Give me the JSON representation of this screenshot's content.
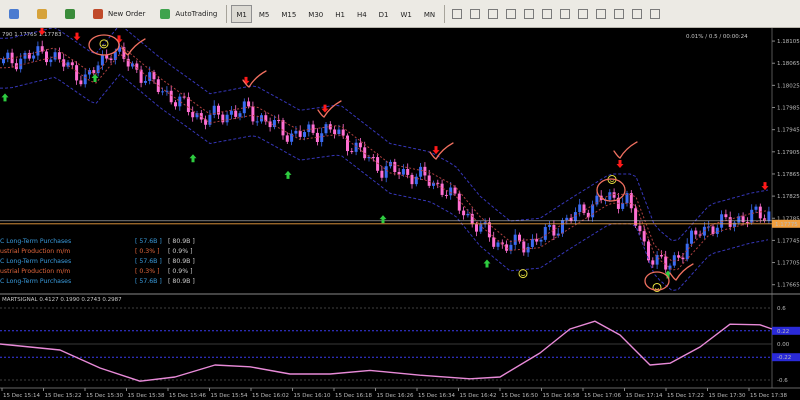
{
  "toolbar": {
    "buttons": [
      {
        "label": "",
        "icon": "new-chart-icon"
      },
      {
        "label": "",
        "icon": "profiles-icon"
      },
      {
        "label": "",
        "icon": "navigator-icon"
      },
      {
        "label": "New Order",
        "icon": "new-order-icon"
      },
      {
        "label": "AutoTrading",
        "icon": "autotrading-icon"
      }
    ],
    "timeframes": [
      "M1",
      "M5",
      "M15",
      "M30",
      "H1",
      "H4",
      "D1",
      "W1",
      "MN"
    ],
    "active_timeframe": "M1"
  },
  "chart": {
    "symbol_info": "790 1.17765 1.17783",
    "status": "0.01% / 0.5 / 00:00:24",
    "status_color": "#f4a742",
    "current_price": "1.17775",
    "price_labels": [
      "1.18105",
      "1.18065",
      "1.18025",
      "1.17985",
      "1.17945",
      "1.17905",
      "1.17865",
      "1.17825",
      "1.17785",
      "1.17745",
      "1.17705",
      "1.17665"
    ],
    "time_labels": [
      "15 Dec 15:14",
      "15 Dec 15:22",
      "15 Dec 15:30",
      "15 Dec 15:38",
      "15 Dec 15:46",
      "15 Dec 15:54",
      "15 Dec 16:02",
      "15 Dec 16:10",
      "15 Dec 16:18",
      "15 Dec 16:26",
      "15 Dec 16:34",
      "15 Dec 16:42",
      "15 Dec 16:50",
      "15 Dec 16:58",
      "15 Dec 17:06",
      "15 Dec 17:14",
      "15 Dec 17:22",
      "15 Dec 17:30",
      "15 Dec 17:38"
    ],
    "news_events": [
      {
        "name": "C Long-Term Purchases",
        "actual": "[ 57.6B ]",
        "previous": "[ 80.9B ]",
        "color": "#3a9bdc"
      },
      {
        "name": "ustrial Production m/m",
        "actual": "[ 0.3% ]",
        "previous": "[ 0.9% ]",
        "color": "#e0663c"
      },
      {
        "name": "C Long-Term Purchases",
        "actual": "[ 57.6B ]",
        "previous": "[ 80.9B ]",
        "color": "#3a9bdc"
      },
      {
        "name": "ustrial Production m/m",
        "actual": "[ 0.3% ]",
        "previous": "[ 0.9% ]",
        "color": "#e0663c"
      },
      {
        "name": "C Long-Term Purchases",
        "actual": "[ 57.6B ]",
        "previous": "[ 80.9B ]",
        "color": "#3a9bdc"
      }
    ],
    "colors": {
      "bull_candle": "#3b6cf2",
      "bear_candle": "#ff6fd2",
      "band": "#3636b8",
      "mid_band": "#b04040",
      "buy_arrow": "#2ecc40",
      "sell_arrow": "#ff1a1a",
      "annotation": "#f07060"
    }
  },
  "indicator": {
    "label": "MARTSIGNAL 0.4127 0.1990 0.2743 0.2987",
    "axis_labels": [
      "0.6",
      "0.22",
      "0.00",
      "-0.22",
      "-0.6"
    ],
    "line_color": "#e88ad8"
  }
}
